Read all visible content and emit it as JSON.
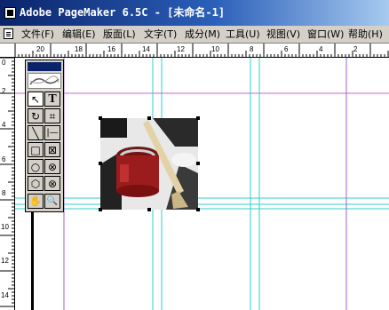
{
  "window": {
    "title": "Adobe PageMaker 6.5C - [未命名-1]"
  },
  "menubar": {
    "items": [
      "文件(F)",
      "编辑(E)",
      "版面(L)",
      "文字(T)",
      "成分(M)",
      "工具(U)",
      "视图(V)",
      "窗口(W)",
      "帮助(H)"
    ]
  },
  "ruler": {
    "horizontal_labels": [
      "20",
      "18",
      "16",
      "14",
      "12",
      "10",
      "8",
      "6",
      "4",
      "2"
    ],
    "vertical_labels": [
      "0",
      "2",
      "4",
      "6",
      "8",
      "10",
      "12",
      "14"
    ]
  },
  "toolbox": {
    "tools": [
      {
        "name": "pointer-tool",
        "glyph": "↖",
        "selected": true
      },
      {
        "name": "text-tool",
        "glyph": "T",
        "selected": false
      },
      {
        "name": "rotate-tool",
        "glyph": "↻",
        "selected": false
      },
      {
        "name": "crop-tool",
        "glyph": "⌗",
        "selected": false
      },
      {
        "name": "line-tool",
        "glyph": "╲",
        "selected": false
      },
      {
        "name": "constrained-line-tool",
        "glyph": "|—",
        "selected": false
      },
      {
        "name": "rectangle-tool",
        "glyph": "□",
        "selected": false
      },
      {
        "name": "rectangle-frame-tool",
        "glyph": "⊠",
        "selected": false
      },
      {
        "name": "ellipse-tool",
        "glyph": "○",
        "selected": false
      },
      {
        "name": "ellipse-frame-tool",
        "glyph": "⊗",
        "selected": false
      },
      {
        "name": "polygon-tool",
        "glyph": "⬡",
        "selected": false
      },
      {
        "name": "polygon-frame-tool",
        "glyph": "⊗",
        "selected": false
      },
      {
        "name": "hand-tool",
        "glyph": "✋",
        "selected": false
      },
      {
        "name": "zoom-tool",
        "glyph": "🔍",
        "selected": false
      }
    ]
  },
  "colors": {
    "guide_cyan": "#33cccc",
    "margin_magenta": "#cc66cc",
    "column_purple": "#9966cc"
  }
}
